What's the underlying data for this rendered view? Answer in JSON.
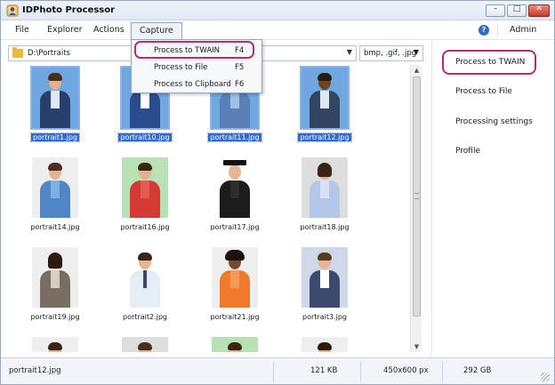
{
  "window": {
    "title": "IDPhoto Processor"
  },
  "menu": {
    "file": "File",
    "explorer": "Explorer",
    "actions": "Actions",
    "capture": "Capture",
    "help_icon": "?",
    "admin": "Admin"
  },
  "capture_menu": {
    "items": [
      {
        "label": "Process to TWAIN",
        "shortcut": "F4",
        "highlighted": true
      },
      {
        "label": "Process to File",
        "shortcut": "F5"
      },
      {
        "label": "Process to Clipboard",
        "shortcut": "F6"
      }
    ]
  },
  "path": {
    "value": "D:\\Portraits"
  },
  "filter": {
    "value": "bmp, .gif, .jpg"
  },
  "gallery": {
    "tiles": [
      {
        "label": "portrait1.jpg",
        "selected": true
      },
      {
        "label": "portrait10.jpg",
        "selected": true
      },
      {
        "label": "portrait11.jpg",
        "selected": true
      },
      {
        "label": "portrait12.jpg",
        "selected": true
      },
      {
        "label": "portrait14.jpg",
        "selected": false
      },
      {
        "label": "portrait16.jpg",
        "selected": false
      },
      {
        "label": "portrait17.jpg",
        "selected": false
      },
      {
        "label": "portrait18.jpg",
        "selected": false
      },
      {
        "label": "portrait19.jpg",
        "selected": false
      },
      {
        "label": "portrait2.jpg",
        "selected": false
      },
      {
        "label": "portrait21.jpg",
        "selected": false
      },
      {
        "label": "portrait3.jpg",
        "selected": false
      }
    ]
  },
  "right_panel": {
    "items": [
      {
        "label": "Process to TWAIN",
        "highlighted": true
      },
      {
        "label": "Process to File"
      },
      {
        "label": "Processing settings"
      },
      {
        "label": "Profile"
      }
    ]
  },
  "status": {
    "filename": "portrait12.jpg",
    "size": "121 KB",
    "dimensions": "450x600 px",
    "disk": "292 GB"
  },
  "icons": {
    "app": "person-badge-icon",
    "folder": "folder-icon",
    "help": "help-icon",
    "dropdown": "chevron-down-icon"
  },
  "colors": {
    "selection": "#2f6bd3",
    "highlight_ring": "#a8316f",
    "help_blue": "#2f6bc4"
  }
}
